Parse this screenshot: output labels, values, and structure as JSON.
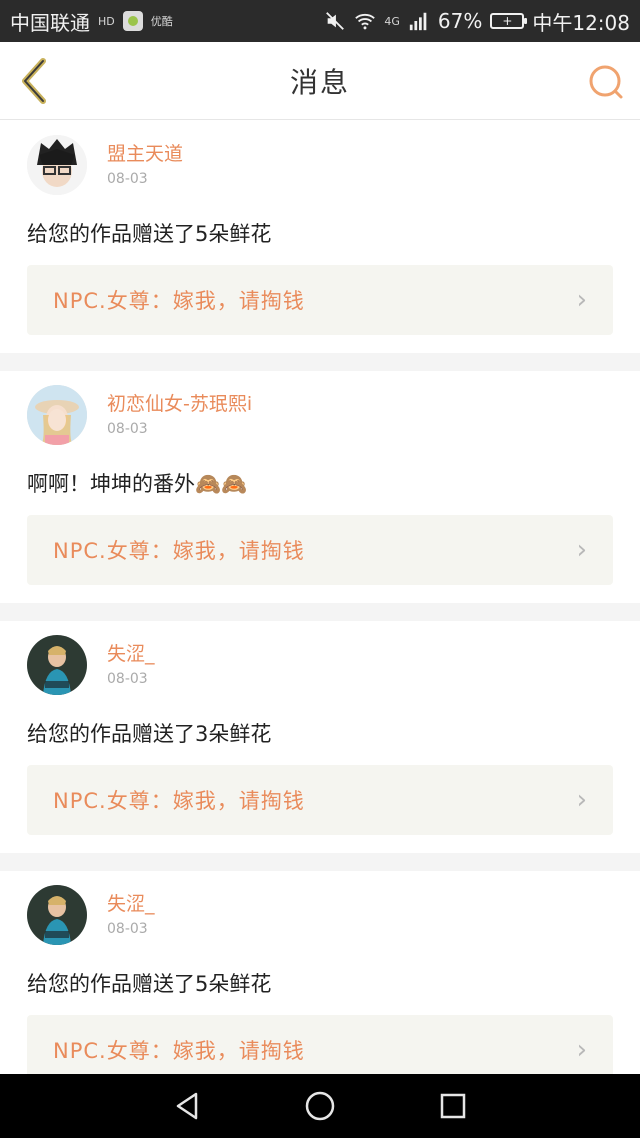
{
  "status_bar": {
    "carrier": "中国联通",
    "carrier_small": "HD",
    "app_label": "优酷",
    "network": "4G",
    "battery": "67%",
    "time": "中午12:08"
  },
  "header": {
    "title": "消息",
    "back_icon": "chevron-left-icon",
    "search_icon": "search-icon"
  },
  "notifications": [
    {
      "username": "盟主天道",
      "date": "08-03",
      "message": "给您的作品赠送了5朵鲜花",
      "quote": "NPC.女尊：嫁我，请掏钱",
      "avatar": "avatar-anime-glasses"
    },
    {
      "username": "初恋仙女-苏珉熙i",
      "date": "08-03",
      "message": "啊啊！坤坤的番外🙈🙈",
      "quote": "NPC.女尊：嫁我，请掏钱",
      "avatar": "avatar-girl-hat"
    },
    {
      "username": "失涩_",
      "date": "08-03",
      "message": "给您的作品赠送了3朵鲜花",
      "quote": "NPC.女尊：嫁我，请掏钱",
      "avatar": "avatar-photo-dark"
    },
    {
      "username": "失涩_",
      "date": "08-03",
      "message": "给您的作品赠送了5朵鲜花",
      "quote": "NPC.女尊：嫁我，请掏钱",
      "avatar": "avatar-photo-dark"
    }
  ],
  "nav": {
    "back": "back-triangle-icon",
    "home": "home-circle-icon",
    "recent": "recent-square-icon"
  },
  "colors": {
    "accent": "#e98b5b",
    "search_accent": "#f0a36f",
    "back_icon": "#c8b15b"
  }
}
